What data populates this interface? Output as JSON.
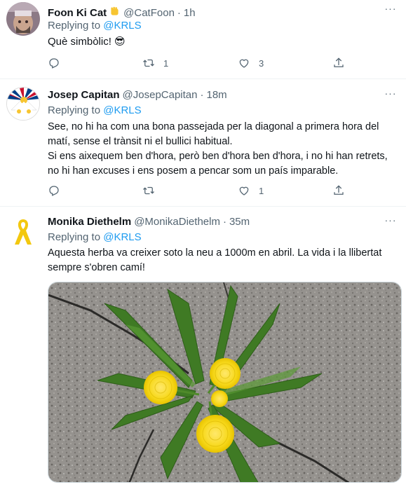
{
  "tweets": [
    {
      "name": "Foon Ki Cat",
      "handle": "@CatFoon",
      "dot": "·",
      "time": "1h",
      "replying_prefix": "Replying to",
      "replying_to": "@KRLS",
      "text": "Què simbòlic! 😎",
      "retweets": "1",
      "likes": "3",
      "replies": "",
      "icons": [
        "reply-icon",
        "retweet-icon",
        "like-icon",
        "share-icon",
        "more-icon",
        "raised-fist-emoji"
      ]
    },
    {
      "name": "Josep Capitan",
      "handle": "@JosepCapitan",
      "dot": "·",
      "time": "18m",
      "replying_prefix": "Replying to",
      "replying_to": "@KRLS",
      "text_lines": [
        "See, no hi ha com una bona passejada per la diagonal a primera hora del",
        "matí, sense el trànsit ni el bullici habitual.",
        "Si ens aixequem ben d'hora, però ben d'hora ben d'hora, i no hi han retrets,",
        "no hi han excuses i ens posem a pencar som un país imparable."
      ],
      "retweets": "",
      "likes": "1",
      "replies": ""
    },
    {
      "name": "Monika Diethelm",
      "handle": "@MonikaDiethelm",
      "dot": "·",
      "time": "35m",
      "replying_prefix": "Replying to",
      "replying_to": "@KRLS",
      "text_lines": [
        "Aquesta herba va creixer soto la neu a 1000m en abril. La vida i la llibertat",
        "sempre s'obren camí!"
      ],
      "media": "photo of dandelion growing through cracked pavement"
    }
  ],
  "colors": {
    "link": "#1d9bf0",
    "secondary": "#536471",
    "divider": "#eff3f4"
  }
}
